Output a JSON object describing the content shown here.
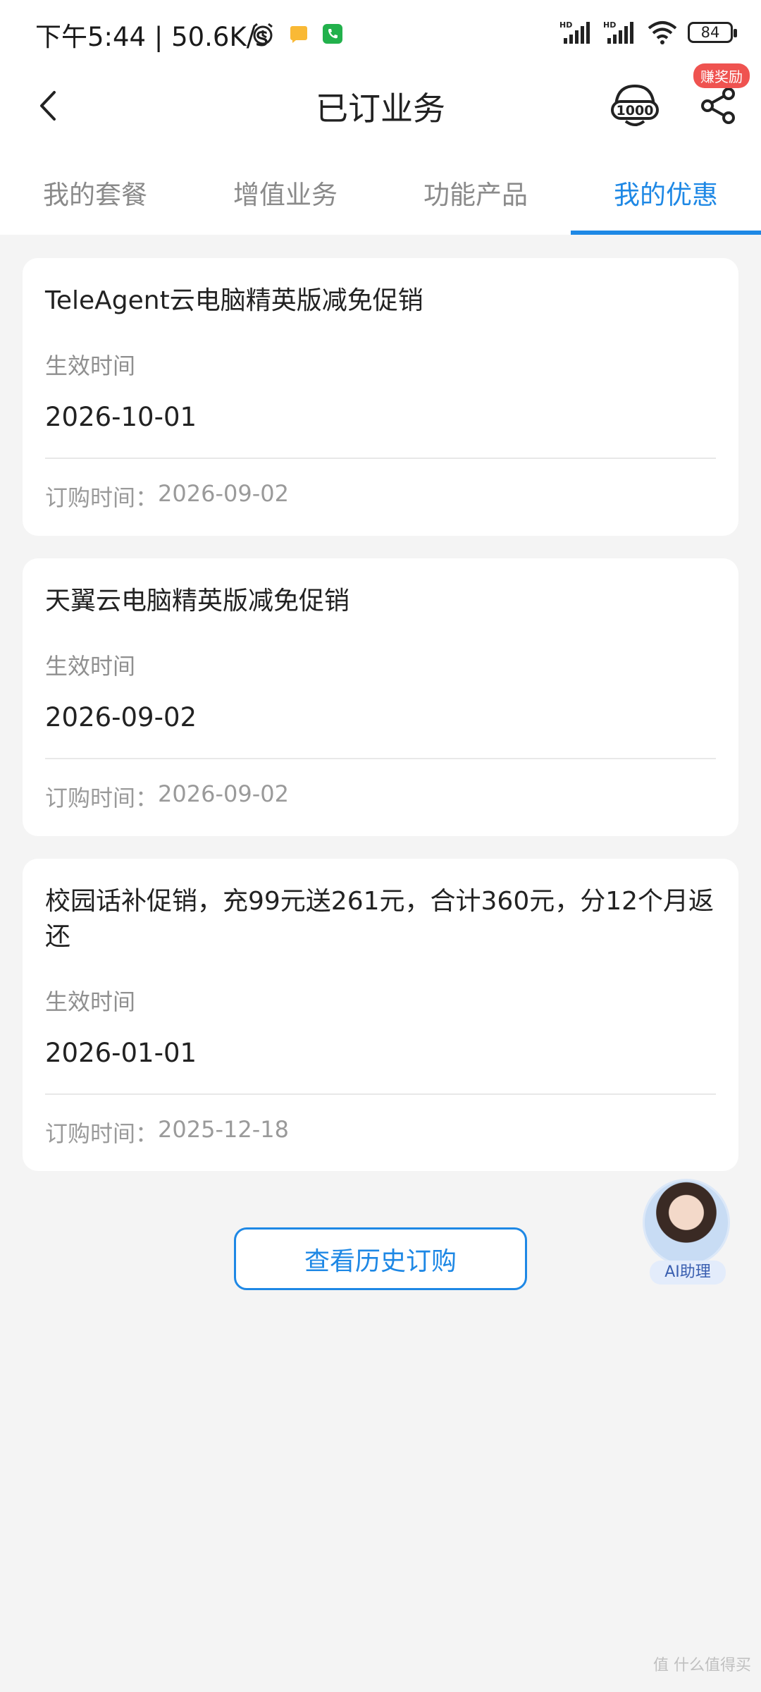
{
  "status_bar": {
    "time": "下午5:44 | 50.6K/s",
    "battery": "84",
    "hd1": "HD",
    "hd2": "HD"
  },
  "header": {
    "title": "已订业务",
    "reward_badge": "赚奖励"
  },
  "tabs": [
    {
      "label": "我的套餐"
    },
    {
      "label": "增值业务"
    },
    {
      "label": "功能产品"
    },
    {
      "label": "我的优惠"
    }
  ],
  "cards": [
    {
      "title": "TeleAgent云电脑精英版减免促销",
      "effective_label": "生效时间",
      "effective_value": "2026-10-01",
      "order_label": "订购时间：",
      "order_value": "2026-09-02"
    },
    {
      "title": "天翼云电脑精英版减免促销",
      "effective_label": "生效时间",
      "effective_value": "2026-09-02",
      "order_label": "订购时间：",
      "order_value": "2026-09-02"
    },
    {
      "title": "校园话补促销，充99元送261元，合计360元，分12个月返还",
      "effective_label": "生效时间",
      "effective_value": "2026-01-01",
      "order_label": "订购时间：",
      "order_value": "2025-12-18"
    }
  ],
  "history_button": "查看历史订购",
  "ai_assistant": {
    "label": "AI助理"
  },
  "watermark": "值 什么值得买",
  "colors": {
    "accent": "#1e88e5",
    "badge": "#ef5350",
    "background": "#f4f4f4"
  }
}
